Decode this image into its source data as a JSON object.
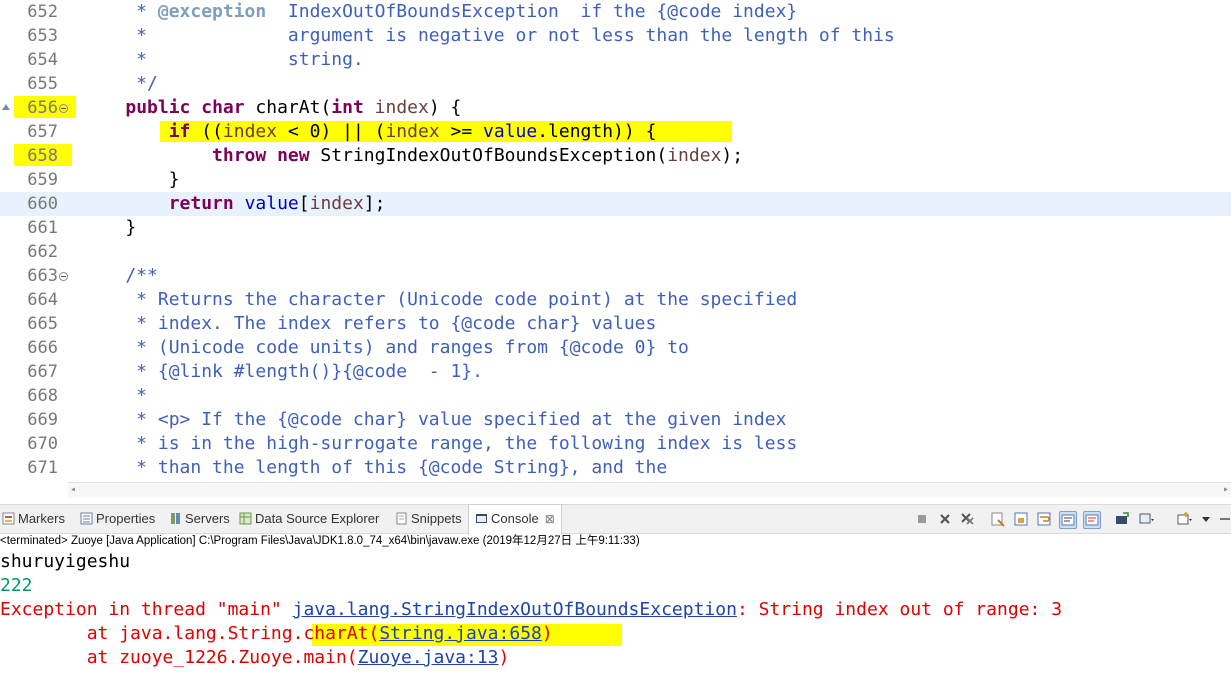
{
  "editor": {
    "lines": [
      {
        "num": "652",
        "tokens": [
          {
            "c": "cm",
            "t": "     * "
          },
          {
            "c": "tag",
            "t": "@exception"
          },
          {
            "c": "cm",
            "t": "  IndexOutOfBoundsException  if the {@code index}"
          }
        ]
      },
      {
        "num": "653",
        "tokens": [
          {
            "c": "cm",
            "t": "     *             argument is negative or not less than the length of this"
          }
        ]
      },
      {
        "num": "654",
        "tokens": [
          {
            "c": "cm",
            "t": "     *             string."
          }
        ]
      },
      {
        "num": "655",
        "tokens": [
          {
            "c": "cm",
            "t": "     */"
          }
        ]
      },
      {
        "num": "656",
        "fold": true,
        "marker": true,
        "tokens": [
          {
            "c": "pl",
            "t": "    "
          },
          {
            "c": "kw",
            "t": "public"
          },
          {
            "c": "pl",
            "t": " "
          },
          {
            "c": "kw",
            "t": "char"
          },
          {
            "c": "pl",
            "t": " charAt("
          },
          {
            "c": "kw",
            "t": "int"
          },
          {
            "c": "pl",
            "t": " "
          },
          {
            "c": "var",
            "t": "index"
          },
          {
            "c": "pl",
            "t": ") {"
          }
        ]
      },
      {
        "num": "657",
        "tokens": [
          {
            "c": "pl",
            "t": "        "
          },
          {
            "c": "kw",
            "t": "if"
          },
          {
            "c": "pl",
            "t": " (("
          },
          {
            "c": "var",
            "t": "index"
          },
          {
            "c": "pl",
            "t": " < 0) || ("
          },
          {
            "c": "var",
            "t": "index"
          },
          {
            "c": "pl",
            "t": " >= "
          },
          {
            "c": "fld",
            "t": "value"
          },
          {
            "c": "pl",
            "t": ".length)) {"
          }
        ]
      },
      {
        "num": "658",
        "tokens": [
          {
            "c": "pl",
            "t": "            "
          },
          {
            "c": "kw",
            "t": "throw"
          },
          {
            "c": "pl",
            "t": " "
          },
          {
            "c": "kw",
            "t": "new"
          },
          {
            "c": "pl",
            "t": " StringIndexOutOfBoundsException("
          },
          {
            "c": "var",
            "t": "index"
          },
          {
            "c": "pl",
            "t": ");"
          }
        ]
      },
      {
        "num": "659",
        "tokens": [
          {
            "c": "pl",
            "t": "        }"
          }
        ]
      },
      {
        "num": "660",
        "current": true,
        "tokens": [
          {
            "c": "pl",
            "t": "        "
          },
          {
            "c": "kw",
            "t": "return"
          },
          {
            "c": "pl",
            "t": " "
          },
          {
            "c": "fld",
            "t": "value"
          },
          {
            "c": "pl",
            "t": "["
          },
          {
            "c": "var",
            "t": "index"
          },
          {
            "c": "pl",
            "t": "];"
          }
        ]
      },
      {
        "num": "661",
        "tokens": [
          {
            "c": "pl",
            "t": "    }"
          }
        ]
      },
      {
        "num": "662",
        "tokens": []
      },
      {
        "num": "663",
        "fold": true,
        "tokens": [
          {
            "c": "cm",
            "t": "    /**"
          }
        ]
      },
      {
        "num": "664",
        "tokens": [
          {
            "c": "cm",
            "t": "     * Returns the character (Unicode code point) at the specified"
          }
        ]
      },
      {
        "num": "665",
        "tokens": [
          {
            "c": "cm",
            "t": "     * index. The index refers to {@code char} values"
          }
        ]
      },
      {
        "num": "666",
        "tokens": [
          {
            "c": "cm",
            "t": "     * (Unicode code units) and ranges from {@code 0} to"
          }
        ]
      },
      {
        "num": "667",
        "tokens": [
          {
            "c": "cm",
            "t": "     * {@link #length()}{@code  - 1}."
          }
        ]
      },
      {
        "num": "668",
        "tokens": [
          {
            "c": "cm",
            "t": "     *"
          }
        ]
      },
      {
        "num": "669",
        "tokens": [
          {
            "c": "cm",
            "t": "     * <p> If the {@code char} value specified at the given index"
          }
        ]
      },
      {
        "num": "670",
        "tokens": [
          {
            "c": "cm",
            "t": "     * is in the high-surrogate range, the following index is less"
          }
        ]
      },
      {
        "num": "671",
        "tokens": [
          {
            "c": "cm",
            "t": "     * than the length of this {@code String}, and the"
          }
        ]
      }
    ]
  },
  "views": {
    "tabs": [
      {
        "label": "Markers",
        "icon": "markers-icon"
      },
      {
        "label": "Properties",
        "icon": "properties-icon"
      },
      {
        "label": "Servers",
        "icon": "servers-icon"
      },
      {
        "label": "Data Source Explorer",
        "icon": "data-source-icon"
      },
      {
        "label": "Snippets",
        "icon": "snippets-icon"
      },
      {
        "label": "Console",
        "icon": "console-icon",
        "active": true,
        "close": "⊠"
      }
    ],
    "toolbar_icons": [
      "terminate-icon",
      "remove-launch-icon",
      "remove-all-terminated-icon",
      "clear-console-icon",
      "scroll-lock-icon",
      "word-wrap-icon",
      "show-stdout-icon",
      "show-stderr-icon",
      "pin-console-icon",
      "display-console-icon",
      "open-console-icon",
      "view-menu-icon"
    ]
  },
  "console": {
    "status": "<terminated> Zuoye [Java Application] C:\\Program Files\\Java\\JDK1.8.0_74_x64\\bin\\javaw.exe (2019年12月27日 上午9:11:33)",
    "out_line": "shuruyigeshu",
    "in_line": "222",
    "exception_prefix": "Exception in thread \"main\" ",
    "exception_class": "java.lang.StringIndexOutOfBoundsException",
    "exception_message": ": String index out of range: 3",
    "trace1_prefix": "\tat java.lang.String.charAt(",
    "trace1_link": "String.java:658",
    "trace1_suffix": ")",
    "trace2_prefix": "\tat zuoye_1226.Zuoye.main(",
    "trace2_link": "Zuoye.java:13",
    "trace2_suffix": ")"
  },
  "colors": {
    "keyword": "#7f0055",
    "comment": "#3f5fbf",
    "javadoc_tag": "#7f9fbf",
    "field": "#0000c0",
    "local_var": "#6a3e3e",
    "highlight": "#ffff00",
    "current_line": "#e8f2fe",
    "stdin": "#009966",
    "stderr": "#e00000",
    "link": "#1c44b0"
  }
}
